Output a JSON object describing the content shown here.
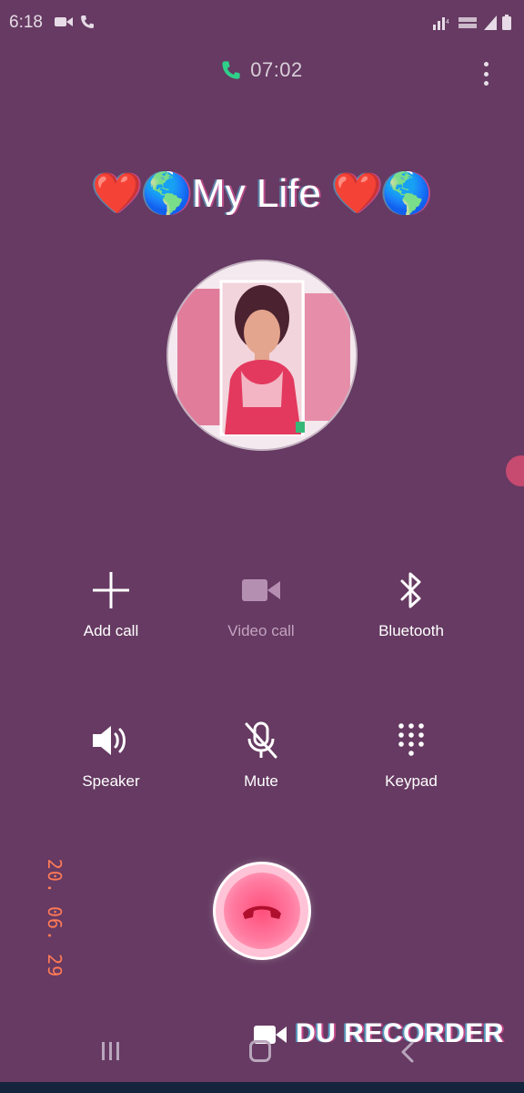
{
  "status_bar": {
    "time": "6:18",
    "left_icons": [
      "video-icon",
      "phone-icon"
    ],
    "right_icons": [
      "signal-volte-icon",
      "network-icon",
      "battery-icon"
    ]
  },
  "call": {
    "duration": "07:02",
    "contact_name": "❤️🌎My Life ❤️🌎"
  },
  "actions": {
    "row1": [
      {
        "label": "Add call",
        "icon": "plus-icon",
        "enabled": true
      },
      {
        "label": "Video call",
        "icon": "video-camera-icon",
        "enabled": false
      },
      {
        "label": "Bluetooth",
        "icon": "bluetooth-icon",
        "enabled": true
      }
    ],
    "row2": [
      {
        "label": "Speaker",
        "icon": "speaker-icon",
        "enabled": true
      },
      {
        "label": "Mute",
        "icon": "mic-off-icon",
        "enabled": true
      },
      {
        "label": "Keypad",
        "icon": "keypad-icon",
        "enabled": true
      }
    ]
  },
  "watermark_date": "20. 06. 29",
  "recorder": {
    "label": "DU RECORDER"
  },
  "colors": {
    "background": "#663a62",
    "end_call": "#ff4f7a",
    "watermark": "#ff7a57"
  }
}
